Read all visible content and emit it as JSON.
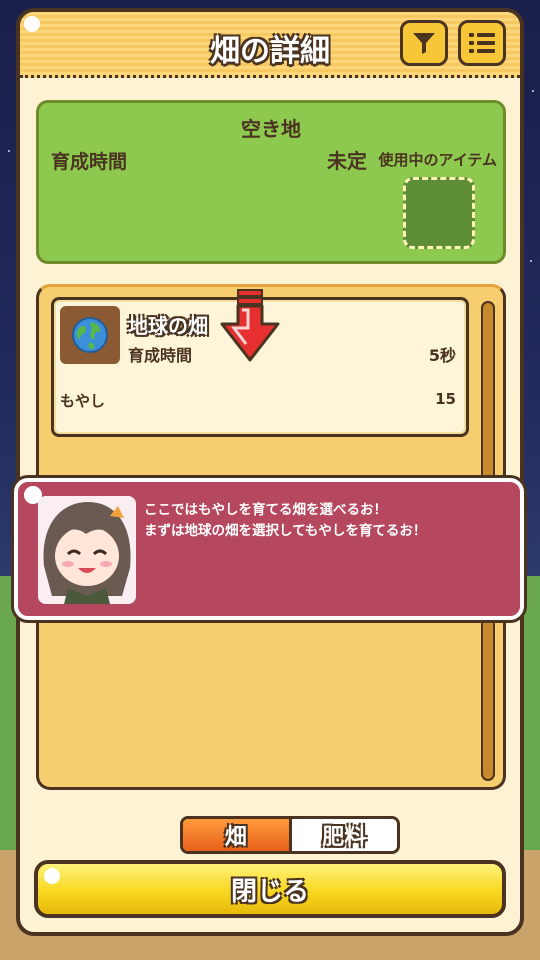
{
  "header": {
    "title": "畑の詳細"
  },
  "header_buttons": {
    "filter_icon": "filter-icon",
    "menu_icon": "list-menu-icon"
  },
  "info": {
    "title": "空き地",
    "grow_time_label": "育成時間",
    "grow_time_value": "未定",
    "item_label": "使用中のアイテム"
  },
  "field_list": {
    "items": [
      {
        "name": "地球の畑",
        "time_label": "育成時間",
        "time_value": "5秒",
        "crop": "もやし",
        "count": "15",
        "icon": "earth-icon"
      }
    ]
  },
  "dialog": {
    "line1": "ここではもやしを育てる畑を選べるお！",
    "line2": "まずは地球の畑を選択してもやしを育てるお！"
  },
  "tabs": {
    "field": "畑",
    "fertilizer": "肥料"
  },
  "close_label": "閉じる",
  "colors": {
    "accent": "#f7c738",
    "dialog": "#b5485e",
    "field_green": "#8ec94f",
    "active_tab": "#e8601c"
  }
}
